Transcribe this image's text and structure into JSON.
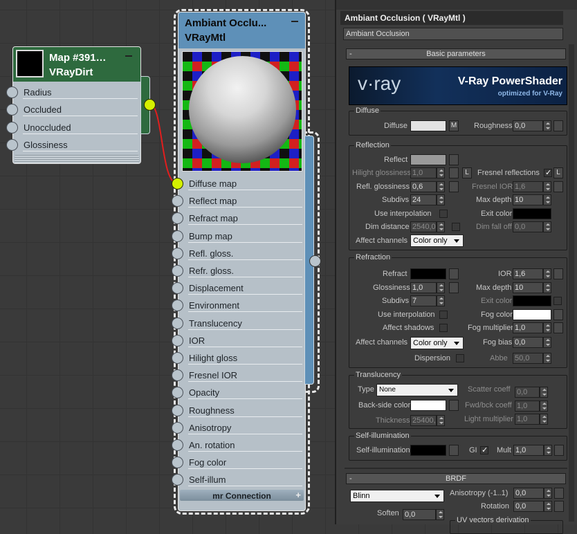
{
  "dirt_node": {
    "title": "Map #391…",
    "subtitle": "VRayDirt",
    "inputs": [
      "Radius",
      "Occluded",
      "Unoccluded",
      "Glossiness"
    ]
  },
  "mtl_node": {
    "title": "Ambiant Occlu...",
    "subtitle": "VRayMtl",
    "slots": [
      "Diffuse map",
      "Reflect map",
      "Refract map",
      "Bump map",
      "Refl. gloss.",
      "Refr. gloss.",
      "Displacement",
      "Environment",
      "Translucency",
      "IOR",
      "Hilight gloss",
      "Fresnel IOR",
      "Opacity",
      "Roughness",
      "Anisotropy",
      "An. rotation",
      "Fog color",
      "Self-illum"
    ],
    "footer": "mr Connection",
    "footer_icon": "+"
  },
  "panel": {
    "title": "Ambiant Occlusion  ( VRayMtl )",
    "name": "Ambiant Occlusion",
    "rollup_basic": "Basic parameters",
    "minus": "-",
    "banner": {
      "title": "V-Ray PowerShader",
      "subtitle": "optimized for V-Ray",
      "logo": "v·ray"
    },
    "diffuse": {
      "group": "Diffuse",
      "label": "Diffuse",
      "m": "M",
      "roughness_label": "Roughness",
      "roughness": "0,0",
      "color": "#e2e2e2"
    },
    "reflection": {
      "group": "Reflection",
      "reflect": "Reflect",
      "reflect_color": "#9a9a9a",
      "hilight_label": "Hilight glossiness",
      "hilight": "1,0",
      "l": "L",
      "fresnel_label": "Fresnel reflections",
      "fresnel_checked": true,
      "refl_gloss_label": "Refl. glossiness",
      "refl_gloss": "0,6",
      "fresnel_ior_label": "Fresnel IOR",
      "fresnel_ior": "1,6",
      "subdivs_label": "Subdivs",
      "subdivs": "24",
      "max_depth_label": "Max depth",
      "max_depth": "10",
      "use_interp": "Use interpolation",
      "exit_color": "Exit color",
      "dim_dist_label": "Dim distance",
      "dim_dist": "2540,0",
      "dim_falloff_label": "Dim fall off",
      "dim_falloff": "0,0",
      "affect_label": "Affect channels",
      "affect": "Color only"
    },
    "refraction": {
      "group": "Refraction",
      "refract": "Refract",
      "ior_label": "IOR",
      "ior": "1,6",
      "gloss_label": "Glossiness",
      "gloss": "1,0",
      "max_depth_label": "Max depth",
      "max_depth": "10",
      "subdivs_label": "Subdivs",
      "subdivs": "7",
      "exit_color": "Exit color",
      "use_interp": "Use interpolation",
      "fog_color": "Fog color",
      "affect_shadows": "Affect shadows",
      "fog_mult_label": "Fog multiplier",
      "fog_mult": "1,0",
      "affect_label": "Affect channels",
      "affect": "Color only",
      "fog_bias_label": "Fog bias",
      "fog_bias": "0,0",
      "dispersion": "Dispersion",
      "abbe_label": "Abbe",
      "abbe": "50,0"
    },
    "translucency": {
      "group": "Translucency",
      "type_label": "Type",
      "type": "None",
      "scatter_label": "Scatter coeff",
      "scatter": "0,0",
      "backside": "Back-side color",
      "fwd_label": "Fwd/bck coeff",
      "fwd": "1,0",
      "thickness_label": "Thickness",
      "thickness": "25400,",
      "light_mult_label": "Light multiplier",
      "light_mult": "1,0"
    },
    "selfillum": {
      "group": "Self-illumination",
      "label": "Self-illumination",
      "gi": "GI",
      "gi_checked": true,
      "mult_label": "Mult",
      "mult": "1,0"
    },
    "brdf": {
      "rollup": "BRDF",
      "type": "Blinn",
      "aniso_label": "Anisotropy (-1..1)",
      "aniso": "0,0",
      "rotation_label": "Rotation",
      "rotation": "0,0",
      "soften_label": "Soften",
      "soften": "0,0",
      "uv_group": "UV vectors derivation"
    }
  }
}
